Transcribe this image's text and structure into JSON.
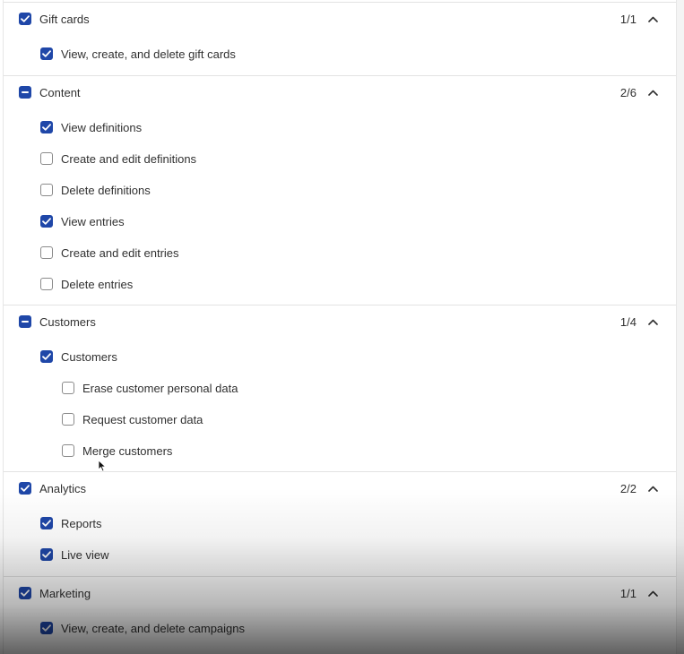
{
  "colors": {
    "accent": "#1f47a8",
    "text": "#303030",
    "divider": "#e3e3e3"
  },
  "sections": [
    {
      "id": "gift-cards",
      "title": "Gift cards",
      "count": "1/1",
      "state": "checked",
      "items": [
        {
          "label": "View, create, and delete gift cards",
          "checked": true,
          "level": 1
        }
      ]
    },
    {
      "id": "content",
      "title": "Content",
      "count": "2/6",
      "state": "mixed",
      "items": [
        {
          "label": "View definitions",
          "checked": true,
          "level": 1
        },
        {
          "label": "Create and edit definitions",
          "checked": false,
          "level": 1
        },
        {
          "label": "Delete definitions",
          "checked": false,
          "level": 1
        },
        {
          "label": "View entries",
          "checked": true,
          "level": 1
        },
        {
          "label": "Create and edit entries",
          "checked": false,
          "level": 1
        },
        {
          "label": "Delete entries",
          "checked": false,
          "level": 1
        }
      ]
    },
    {
      "id": "customers",
      "title": "Customers",
      "count": "1/4",
      "state": "mixed",
      "items": [
        {
          "label": "Customers",
          "checked": true,
          "level": 1
        },
        {
          "label": "Erase customer personal data",
          "checked": false,
          "level": 2
        },
        {
          "label": "Request customer data",
          "checked": false,
          "level": 2
        },
        {
          "label": "Merge customers",
          "checked": false,
          "level": 2
        }
      ]
    },
    {
      "id": "analytics",
      "title": "Analytics",
      "count": "2/2",
      "state": "checked",
      "items": [
        {
          "label": "Reports",
          "checked": true,
          "level": 1
        },
        {
          "label": "Live view",
          "checked": true,
          "level": 1
        }
      ]
    },
    {
      "id": "marketing",
      "title": "Marketing",
      "count": "1/1",
      "state": "checked",
      "items": [
        {
          "label": "View, create, and delete campaigns",
          "checked": true,
          "level": 1
        }
      ]
    }
  ]
}
